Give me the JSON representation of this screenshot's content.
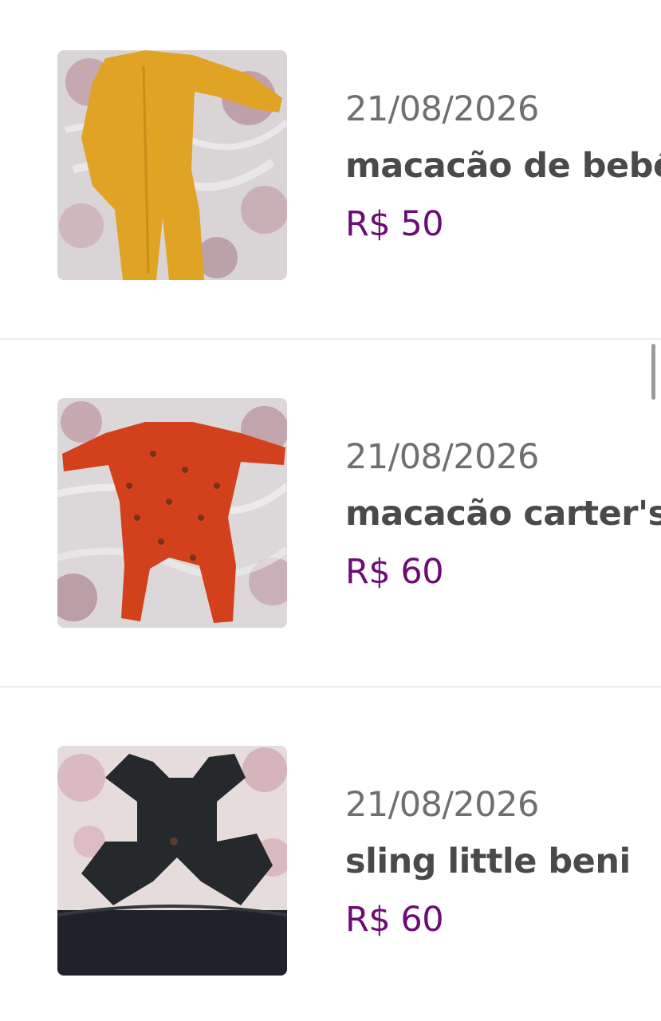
{
  "listings": [
    {
      "date": "21/08/2026",
      "title": "macacão de bebê",
      "price": "R$ 50",
      "image_icon": "yellow-romper-photo"
    },
    {
      "date": "21/08/2026",
      "title": "macacão carter's",
      "price": "R$ 60",
      "image_icon": "orange-romper-photo"
    },
    {
      "date": "21/08/2026",
      "title": "sling little beni",
      "price": "R$ 60",
      "image_icon": "black-sling-photo"
    }
  ],
  "colors": {
    "date_text": "#6f6f6f",
    "title_text": "#4a4a4a",
    "price_text": "#6d0c75",
    "divider": "#ececec"
  }
}
